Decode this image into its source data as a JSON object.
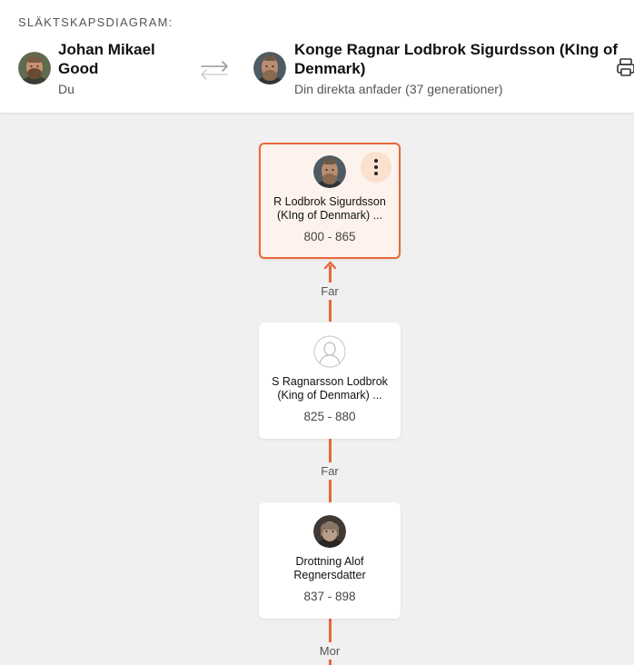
{
  "header": {
    "section_label": "SLÄKTSKAPSDIAGRAM:",
    "from_person": {
      "name": "Johan Mikael Good",
      "subtitle": "Du"
    },
    "to_person": {
      "name": "Konge Ragnar Lodbrok Sigurdsson (KIng of Denmark)",
      "subtitle": "Din direkta anfader (37 generationer)"
    },
    "swap_icon": "swap-arrows-icon",
    "print_icon": "printer-icon"
  },
  "chain": [
    {
      "name": "R Lodbrok Sigurdsson (KIng of Denmark) ...",
      "dates": "800 - 865",
      "avatar": "photo",
      "selected": true
    },
    {
      "relation": "Far"
    },
    {
      "name": "S Ragnarsson Lodbrok (King of Denmark) ...",
      "dates": "825 - 880",
      "avatar": "placeholder",
      "selected": false
    },
    {
      "relation": "Far"
    },
    {
      "name": "Drottning Alof Regnersdatter",
      "dates": "837 - 898",
      "avatar": "photo",
      "selected": false
    },
    {
      "relation": "Mor"
    }
  ],
  "colors": {
    "accent": "#e8673a",
    "selected_bg": "#fdf3ec",
    "menu_button_bg": "#fbe1cf",
    "canvas_bg": "#f0f0f0"
  }
}
